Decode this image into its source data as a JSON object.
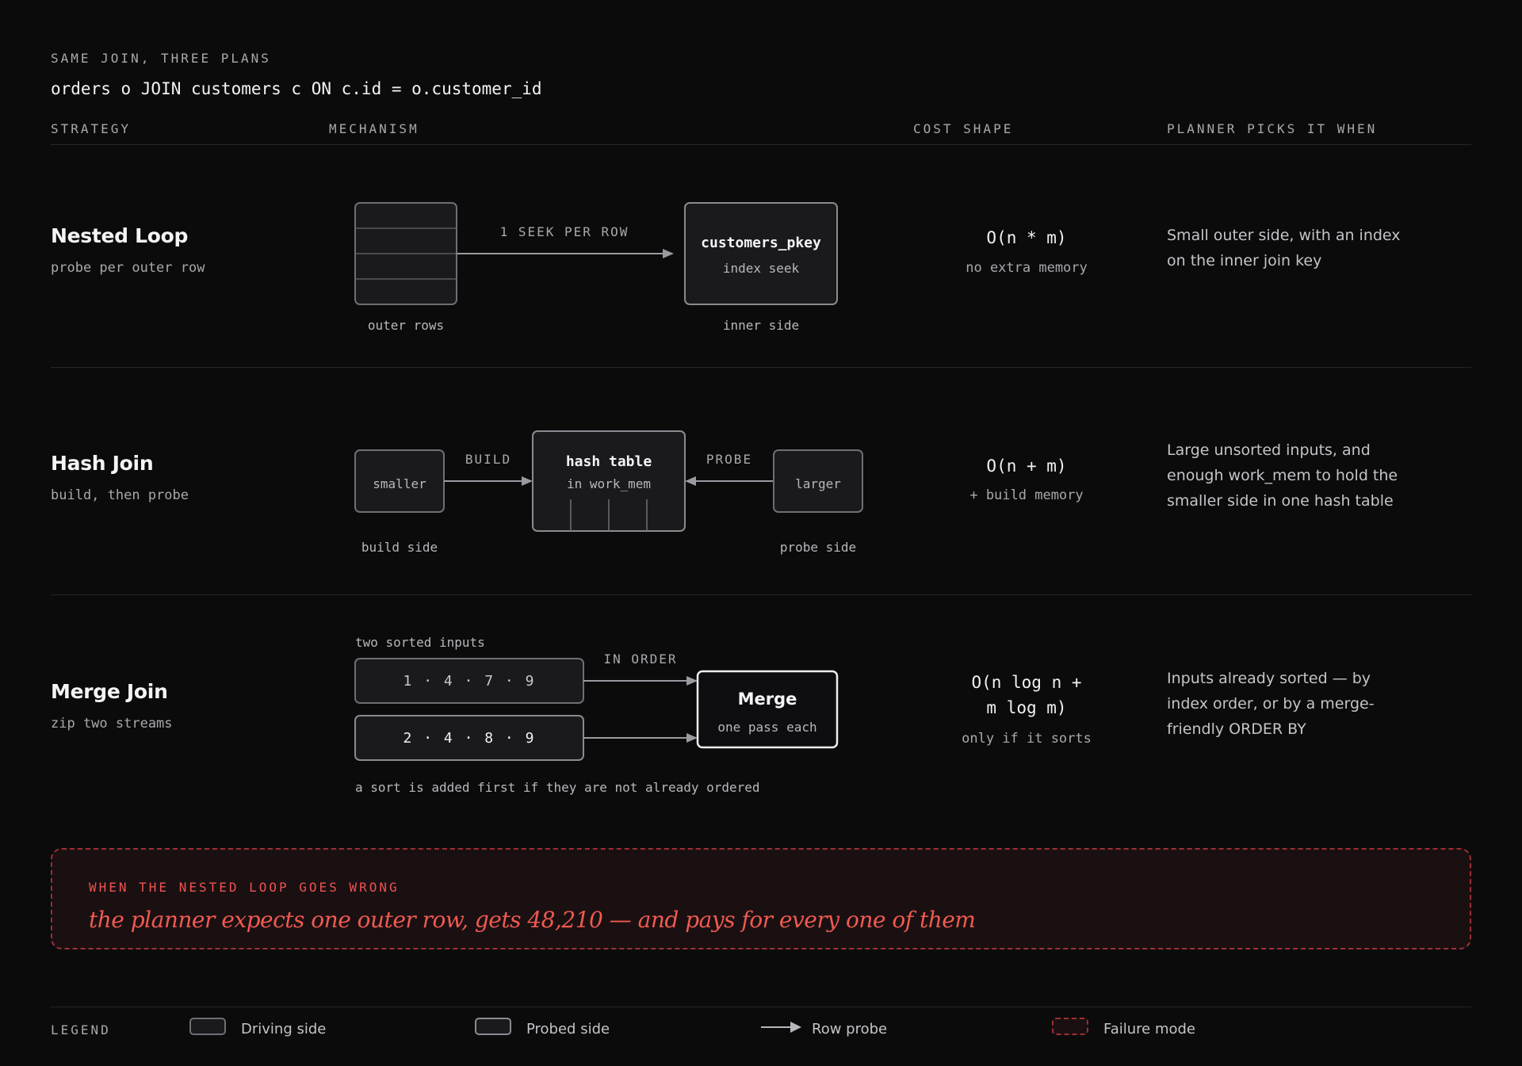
{
  "header": {
    "eyebrow": "SAME JOIN, THREE PLANS",
    "query": "orders o JOIN customers c ON c.id = o.customer_id"
  },
  "columns": {
    "strategy": "STRATEGY",
    "mechanism": "MECHANISM",
    "cost": "COST SHAPE",
    "picks": "PLANNER PICKS IT WHEN"
  },
  "rows": {
    "nested": {
      "title": "Nested Loop",
      "subtitle": "probe per outer row",
      "diagram": {
        "arrow_label": "1 SEEK PER ROW",
        "inner_name": "customers_pkey",
        "inner_detail": "index seek",
        "outer_caption": "outer rows",
        "inner_caption": "inner side"
      },
      "cost": "O(n * m)",
      "cost_note": "no extra memory",
      "picks": [
        "Small outer side, with an index",
        "on the inner join key"
      ]
    },
    "hash": {
      "title": "Hash Join",
      "subtitle": "build, then probe",
      "diagram": {
        "smaller": "smaller",
        "build": "BUILD",
        "hash_name": "hash table",
        "hash_detail": "in work_mem",
        "probe": "PROBE",
        "larger": "larger",
        "build_caption": "build side",
        "probe_caption": "probe side"
      },
      "cost": "O(n + m)",
      "cost_note": "+ build memory",
      "picks": [
        "Large unsorted inputs, and",
        "enough work_mem to hold the",
        "smaller side in one hash table"
      ]
    },
    "merge": {
      "title": "Merge Join",
      "subtitle": "zip two streams",
      "diagram": {
        "inputs_caption": "two sorted inputs",
        "stream_a": "1 · 4 · 7 · 9",
        "stream_b": "2 · 4 · 8 · 9",
        "in_order": "IN ORDER",
        "merge_name": "Merge",
        "merge_detail": "one pass each",
        "sort_note": "a sort is added first if they are not already ordered"
      },
      "cost_lines": [
        "O(n log n +",
        "m log m)"
      ],
      "cost_note": "only if it sorts",
      "picks": [
        "Inputs already sorted — by",
        "index order, or by a merge-",
        "friendly ORDER BY"
      ]
    }
  },
  "failure": {
    "title": "WHEN THE NESTED LOOP GOES WRONG",
    "text": "the planner expects one outer row, gets 48,210 — and pays for every one of them"
  },
  "legend": {
    "title": "LEGEND",
    "items": [
      {
        "label": "Driving side",
        "icon": "driving-side-swatch"
      },
      {
        "label": "Probed side",
        "icon": "probed-side-swatch"
      },
      {
        "label": "Row probe",
        "icon": "arrow-right-icon"
      },
      {
        "label": "Failure mode",
        "icon": "dashed-red-swatch"
      }
    ]
  },
  "colors": {
    "background": "#0b0b0c",
    "box_fill": "#1a1a1d",
    "box_stroke": "#6e6e74",
    "accent_red": "#ef5350",
    "failure_fill": "#1a1012"
  }
}
